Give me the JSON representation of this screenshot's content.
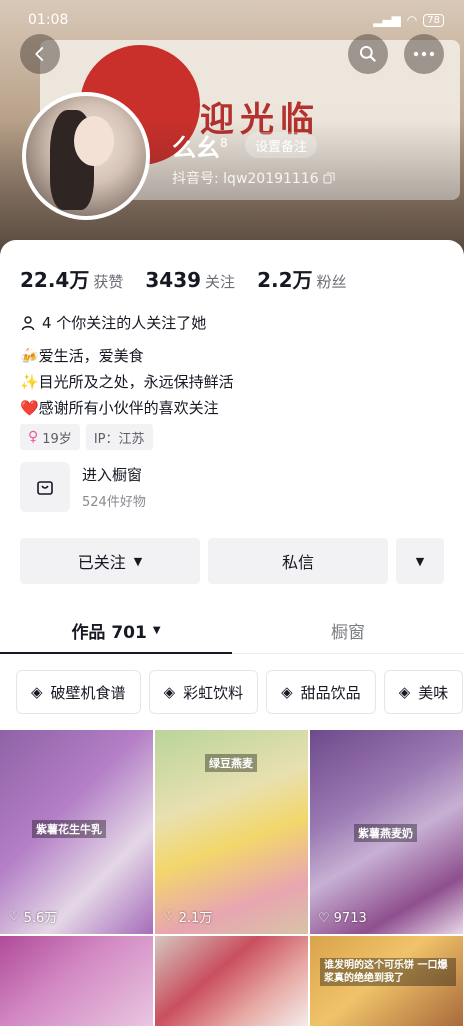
{
  "status_bar": {
    "time": "01:08",
    "signal": "⁵ᴳ",
    "battery": "78"
  },
  "profile": {
    "name": "么幺",
    "name_sup": "8",
    "remark_button": "设置备注",
    "douyin_id": "抖音号: lqw20191116"
  },
  "stats": [
    {
      "value": "22.4万",
      "label": "获赞"
    },
    {
      "value": "3439",
      "label": "关注"
    },
    {
      "value": "2.2万",
      "label": "粉丝"
    }
  ],
  "mutual": "4 个你关注的人关注了她",
  "bio": [
    "🍻爱生活，爱美食",
    "✨目光所及之处，永远保持鲜活",
    "❤️感谢所有小伙伴的喜欢关注"
  ],
  "tags": [
    "19岁",
    "IP：江苏"
  ],
  "shop": {
    "title": "进入橱窗",
    "subtitle": "524件好物"
  },
  "actions": {
    "followed": "已关注",
    "message": "私信"
  },
  "tabs": {
    "works": "作品 701",
    "showcase": "橱窗"
  },
  "collections": [
    "破壁机食谱",
    "彩虹饮料",
    "甜品饮品",
    "美味"
  ],
  "grid": [
    {
      "likes": "5.6万",
      "caption": "紫薯花生牛乳"
    },
    {
      "likes": "2.1万",
      "caption": "绿豆燕麦"
    },
    {
      "likes": "9713",
      "caption": "紫薯燕麦奶"
    }
  ],
  "grid_row2_caption": "谁发明的这个可乐饼 一口爆浆真的绝绝到我了"
}
